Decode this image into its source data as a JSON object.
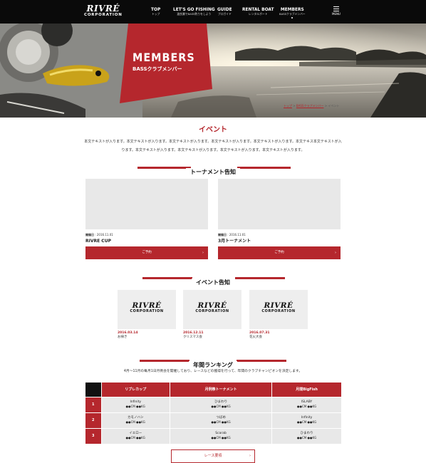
{
  "header": {
    "logo_main": "RIVRÉ",
    "logo_sub": "CORPORATION",
    "nav": [
      {
        "title": "TOP",
        "sub": "トップ"
      },
      {
        "title": "LET'S GO FISHING",
        "sub": "渡良瀬でBASS釣りをしよう"
      },
      {
        "title": "GUIDE",
        "sub": "プロガイド"
      },
      {
        "title": "RENTAL BOAT",
        "sub": "レンタルボート"
      },
      {
        "title": "MEMBERS",
        "sub": "BASSクラブメンバー"
      }
    ],
    "menu_label": "MENU"
  },
  "hero": {
    "title": "MEMBERS",
    "subtitle": "BASSクラブメンバー"
  },
  "breadcrumb": {
    "items": [
      "トップ",
      "BASSクラブメンバー",
      "イベント"
    ],
    "sep": " > "
  },
  "event": {
    "title": "イベント",
    "body": "本文テキストが入ります。本文テキストが入ります。本文テキストが入ります。本文テキストが入ります。本文テキストが入ります。本文テキス本文テキストが入ります。本文テキストが入ります。本文テキストが入ります。本文テキストが入ります。本文テキストが入ります。"
  },
  "tournament": {
    "heading": "トーナメント告知",
    "cards": [
      {
        "date_label": "開催日",
        "date": "2016.11.01",
        "name": "RIVRE CUP",
        "button": "ご予約"
      },
      {
        "date_label": "開催日",
        "date": "2016.11.01",
        "name": "3月トーナメント",
        "button": "ご予約"
      }
    ]
  },
  "events": {
    "heading": "イベント告知",
    "cards": [
      {
        "date": "2016.03.14",
        "name": "お掃き"
      },
      {
        "date": "2016.12.11",
        "name": "クリスマス会"
      },
      {
        "date": "2016.07.31",
        "name": "花火大会"
      }
    ]
  },
  "ranking": {
    "heading": "年間ランキング",
    "note": "4月〜11月の毎月1日月例会を開催しており、レースなどの獲得を行って、年間のクラブチャンピオンを決定します。",
    "columns": [
      "リブレカップ",
      "月例祭トーナメント",
      "月間BigFish"
    ],
    "rows": [
      {
        "rank": "1",
        "cells": [
          {
            "name": "Infinity",
            "score": "●●CM ●●KG"
          },
          {
            "name": "ひまわり",
            "score": "●●CM ●●KG"
          },
          {
            "name": "ISLABY",
            "score": "●●CM ●●KG"
          }
        ]
      },
      {
        "rank": "2",
        "cells": [
          {
            "name": "カモノハシ",
            "score": "●●CM ●●KG"
          },
          {
            "name": "つばめ",
            "score": "●●CM ●●KG"
          },
          {
            "name": "Infinity",
            "score": "●●CM ●●KG"
          }
        ]
      },
      {
        "rank": "3",
        "cells": [
          {
            "name": "イエロー",
            "score": "●●CM ●●KG"
          },
          {
            "name": "Scarab",
            "score": "●●CM ●●KG"
          },
          {
            "name": "ひまわり",
            "score": "●●CM ●●KG"
          }
        ]
      }
    ],
    "race_button": "レース要項"
  },
  "colors": {
    "accent": "#b5272d",
    "header_bg": "#0a0a0a"
  }
}
